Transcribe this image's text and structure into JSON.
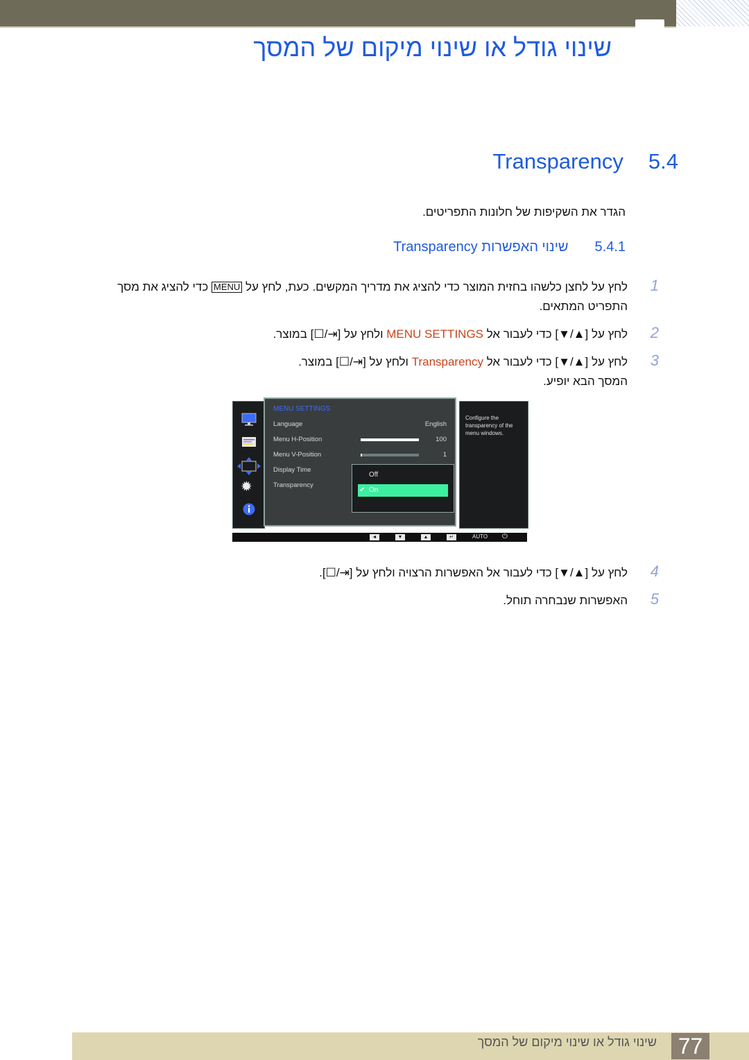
{
  "header": {
    "chapter_title": "שינוי גודל או שינוי מיקום של המסך",
    "colors": {
      "band": "#6e6c58",
      "accent": "#1f5bde",
      "highlight": "#c8451c"
    }
  },
  "section": {
    "number": "5.4",
    "title": "Transparency",
    "intro": "הגדר את השקיפות של חלונות התפריטים."
  },
  "subsection": {
    "number": "5.4.1",
    "title": "שינוי האפשרות Transparency"
  },
  "steps": [
    {
      "num": "1",
      "text_a": "לחץ על לחצן כלשהו בחזית המוצר כדי להציג את מדריך המקשים. כעת, לחץ על ",
      "key": "MENU",
      "text_b": " כדי להציג את מסך התפריט המתאים."
    },
    {
      "num": "2",
      "text_a": "לחץ על [▲/▼] כדי לעבור אל ",
      "highlight": "MENU SETTINGS",
      "text_b": " ולחץ על [",
      "key": "⇥/☐",
      "text_c": "] במוצר."
    },
    {
      "num": "3",
      "text_a": "לחץ על [▲/▼] כדי לעבור אל ",
      "highlight": "Transparency",
      "text_b": " ולחץ על [",
      "key": "⇥/☐",
      "text_c": "] במוצר.",
      "line2": "המסך הבא יופיע."
    },
    {
      "num": "4",
      "text_a": "לחץ על [▲/▼] כדי לעבור אל האפשרות הרצויה ולחץ על [",
      "key": "⇥/☐",
      "text_c": "]."
    },
    {
      "num": "5",
      "text_a": "האפשרות שנבחרה תוחל."
    }
  ],
  "osd": {
    "menu_title": "MENU SETTINGS",
    "side_icons": [
      "monitor-icon",
      "picture-menu-icon",
      "position-arrows-icon",
      "gear-icon",
      "info-icon"
    ],
    "rows": [
      {
        "label": "Language",
        "value": "English"
      },
      {
        "label": "Menu H-Position",
        "value": "100",
        "slider_fraction": 1.0
      },
      {
        "label": "Menu V-Position",
        "value": "1",
        "slider_fraction": 0.01
      },
      {
        "label": "Display Time",
        "value": ""
      },
      {
        "label": "Transparency",
        "value": ""
      }
    ],
    "dropdown": {
      "options": [
        "Off",
        "On"
      ],
      "selected": "On"
    },
    "help_text": "Configure the transparency of the menu windows.",
    "bottom_bar": {
      "buttons": [
        "◄",
        "▼",
        "▲",
        "↵"
      ],
      "auto_label": "AUTO",
      "power_icon": "⏻"
    }
  },
  "footer": {
    "text": "שינוי גודל או שינוי מיקום של המסך",
    "page_number": "77"
  }
}
